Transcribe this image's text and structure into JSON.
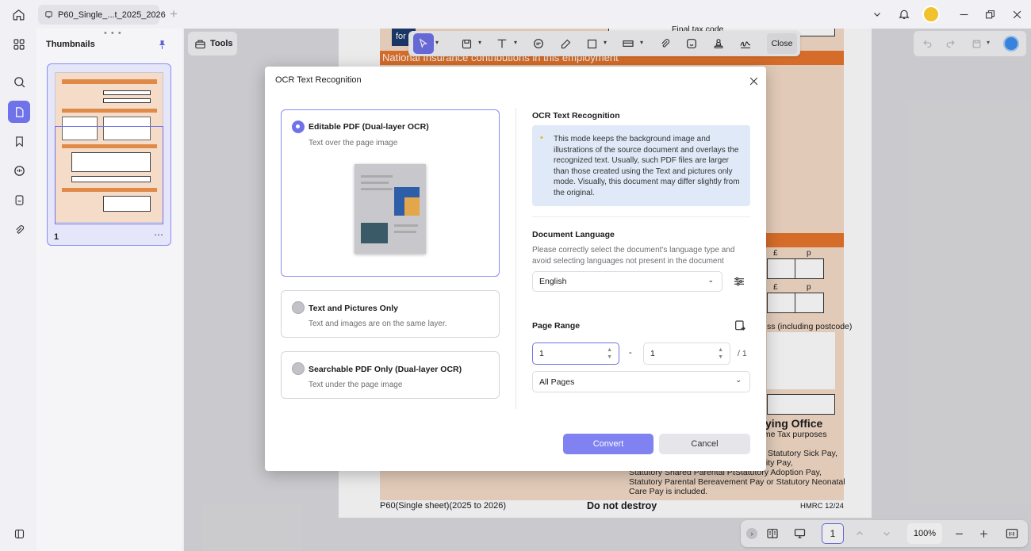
{
  "tab": {
    "title": "P60_Single_...t_2025_2026"
  },
  "left_panel": {
    "title": "Thumbnails",
    "page_number": "1"
  },
  "tools_label": "Tools",
  "toolbar": {
    "close_label": "Close"
  },
  "document": {
    "banner_for": "for",
    "ni_header": "National Insurance contributions in this employment",
    "final_tax_code": "Final tax code",
    "currency_symbol": "£",
    "pence_symbol": "p",
    "address_label": "ss (including postcode)",
    "paying_office": "ying Office",
    "income_tax_purposes": "ome Tax purposes",
    "lines": [
      "Statutory Sick Pay,",
      "nity Pay,",
      "Statutory Adoption Pay,",
      "Statutory Shared Parental Pay, Statutory Adoption Pay,",
      "Statutory Parental Bereavement Pay or Statutory Neonatal",
      "Care Pay is included."
    ],
    "footer_left": "P60(Single sheet)(2025 to 2026)",
    "footer_center": "Do not destroy",
    "footer_right": "HMRC 12/24"
  },
  "bottom": {
    "page_value": "1",
    "zoom": "100%"
  },
  "dialog": {
    "title": "OCR Text Recognition",
    "options": [
      {
        "title": "Editable PDF (Dual-layer OCR)",
        "subtitle": "Text over the page image",
        "selected": true
      },
      {
        "title": "Text and Pictures Only",
        "subtitle": "Text and images are on the same layer.",
        "selected": false
      },
      {
        "title": "Searchable PDF Only (Dual-layer OCR)",
        "subtitle": "Text under the page image",
        "selected": false
      }
    ],
    "ocr_heading": "OCR Text Recognition",
    "ocr_info": "This mode keeps the background image and illustrations of the source document and overlays the recognized text. Usually, such PDF files are larger than those created using the Text and pictures only mode. Visually, this document may differ slightly from the original.",
    "language_heading": "Document Language",
    "language_desc": "Please correctly select the document's language type and avoid selecting languages not present in the document",
    "language_value": "English",
    "range_heading": "Page Range",
    "range_from": "1",
    "range_dash": "-",
    "range_to": "1",
    "range_total": "/ 1",
    "range_select": "All Pages",
    "convert_label": "Convert",
    "cancel_label": "Cancel",
    "accent": "#6f72e8"
  }
}
